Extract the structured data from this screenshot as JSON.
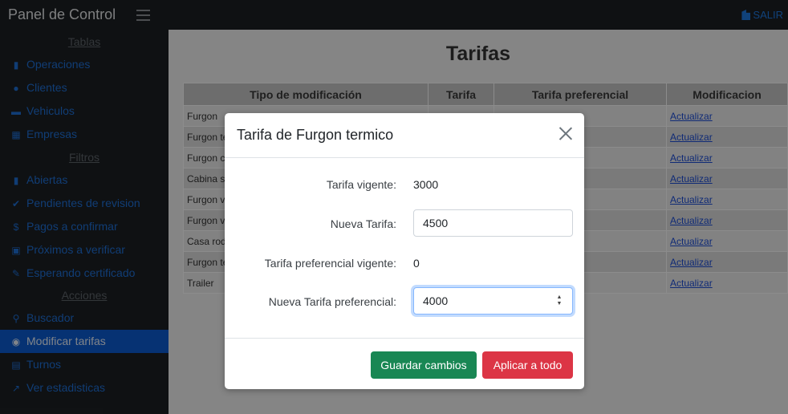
{
  "topbar": {
    "brand": "Panel de Control",
    "logout_label": "SALIR",
    "logout_icon": "door-icon"
  },
  "sidebar": {
    "sections": [
      {
        "title": "Tablas",
        "items": [
          {
            "label": "Operaciones",
            "icon": "clipboard-icon"
          },
          {
            "label": "Clientes",
            "icon": "user-icon"
          },
          {
            "label": "Vehiculos",
            "icon": "car-icon"
          },
          {
            "label": "Empresas",
            "icon": "building-icon"
          }
        ]
      },
      {
        "title": "Filtros",
        "items": [
          {
            "label": "Abiertas",
            "icon": "clipboard-icon"
          },
          {
            "label": "Pendientes de revision",
            "icon": "check-icon"
          },
          {
            "label": "Pagos a confirmar",
            "icon": "dollar-icon"
          },
          {
            "label": "Próximos a verificar",
            "icon": "clipboard-check-icon"
          },
          {
            "label": "Esperando certificado",
            "icon": "edit-document-icon"
          }
        ]
      },
      {
        "title": "Acciones",
        "items": [
          {
            "label": "Buscador",
            "icon": "search-icon"
          },
          {
            "label": "Modificar tarifas",
            "icon": "coins-icon",
            "active": true
          },
          {
            "label": "Turnos",
            "icon": "calendar-icon"
          },
          {
            "label": "Ver estadisticas",
            "icon": "chart-line-icon"
          }
        ]
      }
    ]
  },
  "main": {
    "title": "Tarifas",
    "table": {
      "headers": [
        "Tipo de modificación",
        "Tarifa",
        "Tarifa preferencial",
        "Modificacion"
      ],
      "rows": [
        {
          "tipo": "Furgon",
          "action": "Actualizar"
        },
        {
          "tipo": "Furgon te",
          "action": "Actualizar"
        },
        {
          "tipo": "Furgon co",
          "action": "Actualizar"
        },
        {
          "tipo": "Cabina si",
          "action": "Actualizar"
        },
        {
          "tipo": "Furgon vi",
          "action": "Actualizar"
        },
        {
          "tipo": "Furgon vi",
          "action": "Actualizar"
        },
        {
          "tipo": "Casa roda",
          "action": "Actualizar"
        },
        {
          "tipo": "Furgon te",
          "action": "Actualizar"
        },
        {
          "tipo": "Trailer",
          "action": "Actualizar"
        }
      ]
    }
  },
  "modal": {
    "title": "Tarifa de Furgon termico",
    "current_rate_label": "Tarifa vigente:",
    "current_rate_value": "3000",
    "new_rate_label": "Nueva Tarifa:",
    "new_rate_value": "4500",
    "current_pref_label": "Tarifa preferencial vigente:",
    "current_pref_value": "0",
    "new_pref_label": "Nueva Tarifa preferencial:",
    "new_pref_value": "4000",
    "save_label": "Guardar cambios",
    "apply_all_label": "Aplicar a todo"
  }
}
